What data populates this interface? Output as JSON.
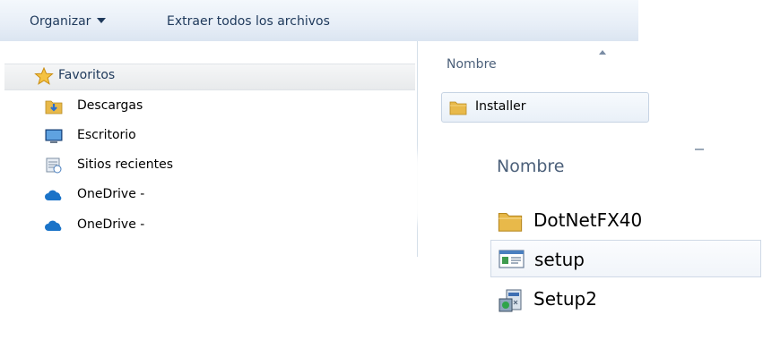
{
  "toolbar": {
    "organize_label": "Organizar",
    "extract_label": "Extraer todos los archivos"
  },
  "nav": {
    "favorites_label": "Favoritos",
    "items": [
      {
        "label": "Descargas",
        "icon": "downloads-folder-icon"
      },
      {
        "label": "Escritorio",
        "icon": "desktop-icon"
      },
      {
        "label": "Sitios recientes",
        "icon": "recent-places-icon"
      },
      {
        "label": "OneDrive - ",
        "icon": "onedrive-cloud-icon"
      },
      {
        "label": "OneDrive - ",
        "icon": "onedrive-cloud-icon"
      }
    ]
  },
  "content": {
    "column_header": "Nombre",
    "rows": [
      {
        "label": "Installer",
        "icon": "folder-icon"
      }
    ]
  },
  "zoom": {
    "column_header": "Nombre",
    "items": [
      {
        "label": "DotNetFX40",
        "icon": "folder-icon"
      },
      {
        "label": "setup",
        "icon": "setup-ini-icon"
      },
      {
        "label": "Setup2",
        "icon": "installer-exe-icon"
      }
    ]
  },
  "colors": {
    "toolbar_text": "#1e395b",
    "folder_yellow": "#e8b94a",
    "onedrive_blue": "#1a73c8",
    "header_text": "#4c607a"
  }
}
